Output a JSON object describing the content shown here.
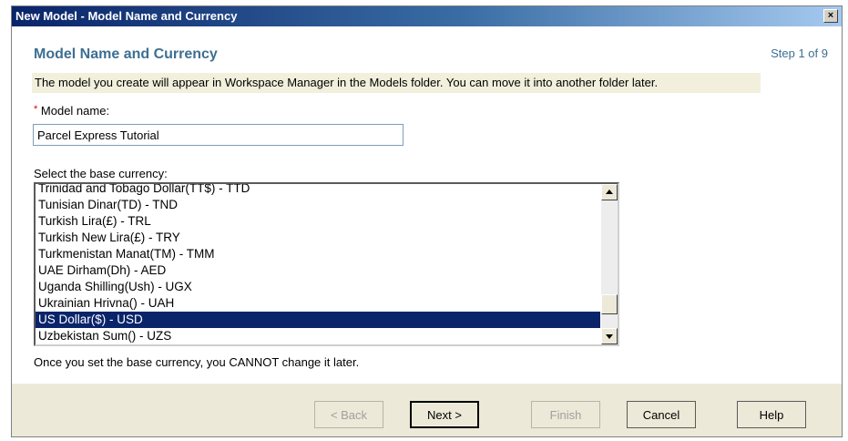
{
  "window": {
    "title": "New Model - Model Name and Currency",
    "close_label": "×"
  },
  "page": {
    "heading": "Model Name and Currency",
    "step": "Step 1 of 9",
    "info": "The model you create will appear in Workspace Manager in the Models folder. You can move it into another folder later.",
    "required_marker": "*",
    "name_label": "Model name:",
    "name_value": "Parcel Express Tutorial",
    "currency_label": "Select the base currency:",
    "currencies": [
      "Trinidad and Tobago Dollar(TT$) - TTD",
      "Tunisian Dinar(TD) - TND",
      "Turkish Lira(£) - TRL",
      "Turkish New Lira(£) - TRY",
      "Turkmenistan Manat(TM) - TMM",
      "UAE Dirham(Dh) - AED",
      "Uganda Shilling(Ush) - UGX",
      "Ukrainian Hrivna() - UAH",
      "US Dollar($) - USD",
      "Uzbekistan Sum() - UZS"
    ],
    "selected_currency_index": 8,
    "currency_note": "Once you set the base currency, you CANNOT change it later."
  },
  "buttons": {
    "back": "< Back",
    "next": "Next >",
    "finish": "Finish",
    "cancel": "Cancel",
    "help": "Help"
  },
  "colors": {
    "accent": "#3d6f93",
    "selection": "#0a246a",
    "info_background": "#f2f0dc",
    "required": "#d80000"
  },
  "icons": {
    "close": "close-icon",
    "scroll_up": "arrow-up-icon",
    "scroll_down": "arrow-down-icon"
  }
}
